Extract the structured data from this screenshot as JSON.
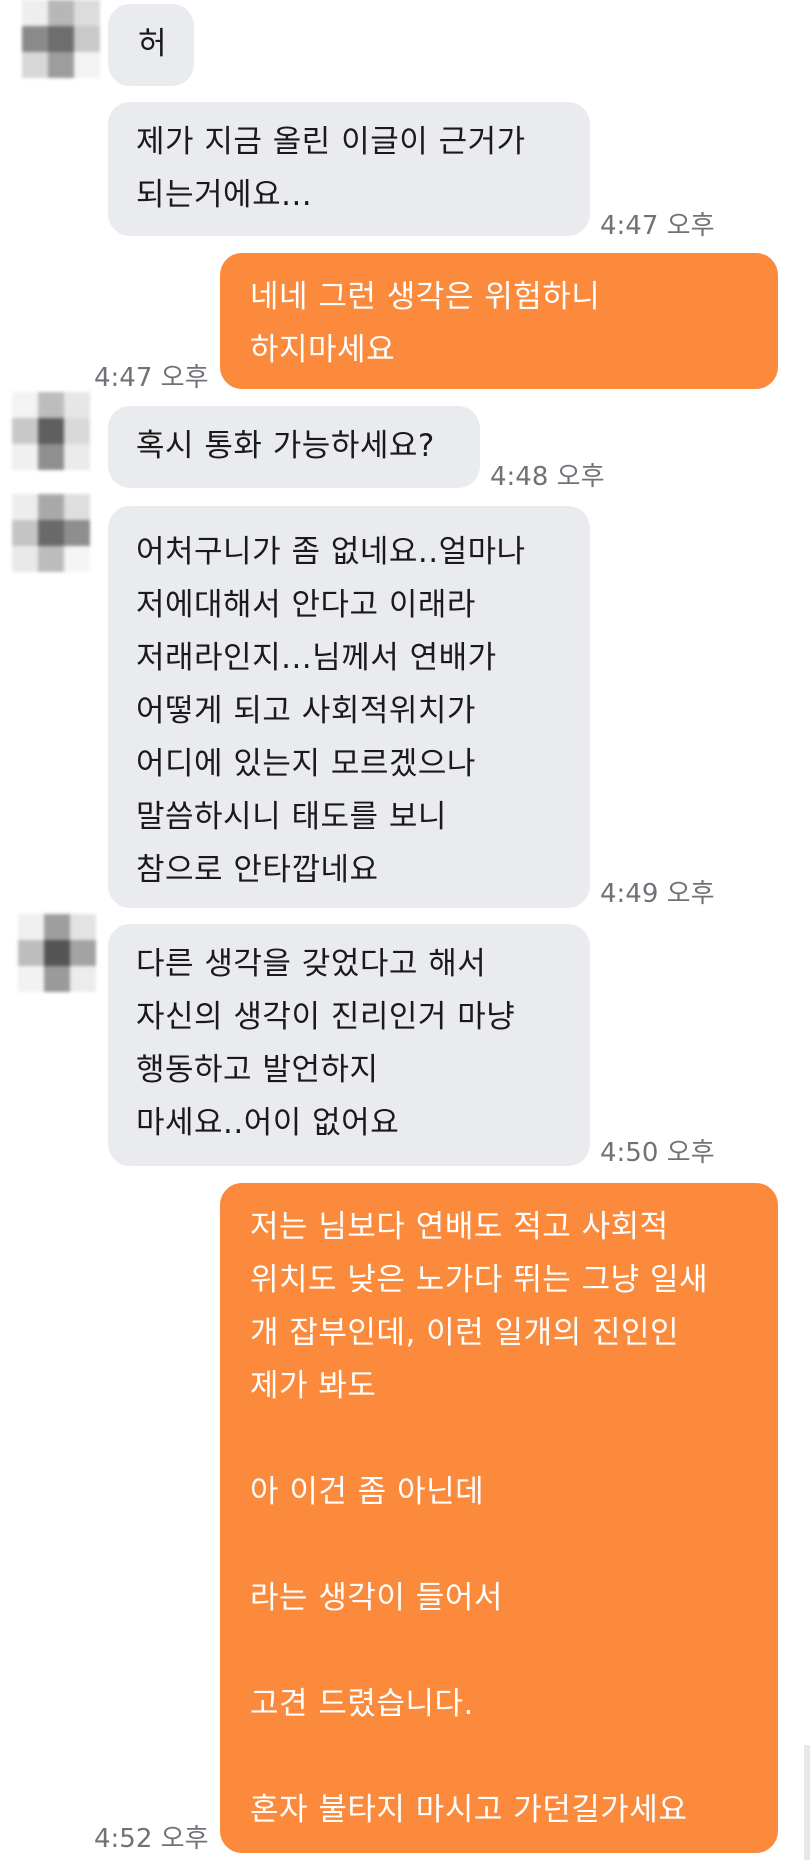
{
  "colors": {
    "incoming_bubble": "#e9ebef",
    "outgoing_bubble": "#fb8a3c",
    "timestamp": "#6f7378",
    "background": "#ffffff"
  },
  "messages": [
    {
      "direction": "in",
      "text": "허",
      "time": ""
    },
    {
      "direction": "in",
      "text": "제가 지금 올린 이글이 근거가\n되는거에요...",
      "time": "4:47 오후"
    },
    {
      "direction": "out",
      "text": "네네 그런 생각은 위험하니\n하지마세요",
      "time": "4:47 오후"
    },
    {
      "direction": "in",
      "text": "혹시 통화 가능하세요?",
      "time": "4:48 오후"
    },
    {
      "direction": "in",
      "text": "어처구니가 좀 없네요..얼마나\n저에대해서 안다고 이래라\n저래라인지...님께서 연배가\n어떻게 되고 사회적위치가\n어디에 있는지 모르겠으나\n말씀하시니 태도를 보니\n참으로 안타깝네요",
      "time": "4:49 오후"
    },
    {
      "direction": "in",
      "text": "다른 생각을 갖었다고 해서\n자신의 생각이 진리인거 마냥\n행동하고 발언하지\n마세요..어이 없어요",
      "time": "4:50 오후"
    },
    {
      "direction": "out",
      "text": "저는 님보다 연배도 적고 사회적\n위치도 낮은 노가다 뛰는 그냥 일새\n개 잡부인데, 이런 일개의 진인인\n제가 봐도\n\n아 이건 좀 아닌데\n\n라는 생각이 들어서\n\n고견 드렸습니다.\n\n혼자 불타지 마시고 가던길가세요",
      "time": "4:52 오후"
    }
  ]
}
